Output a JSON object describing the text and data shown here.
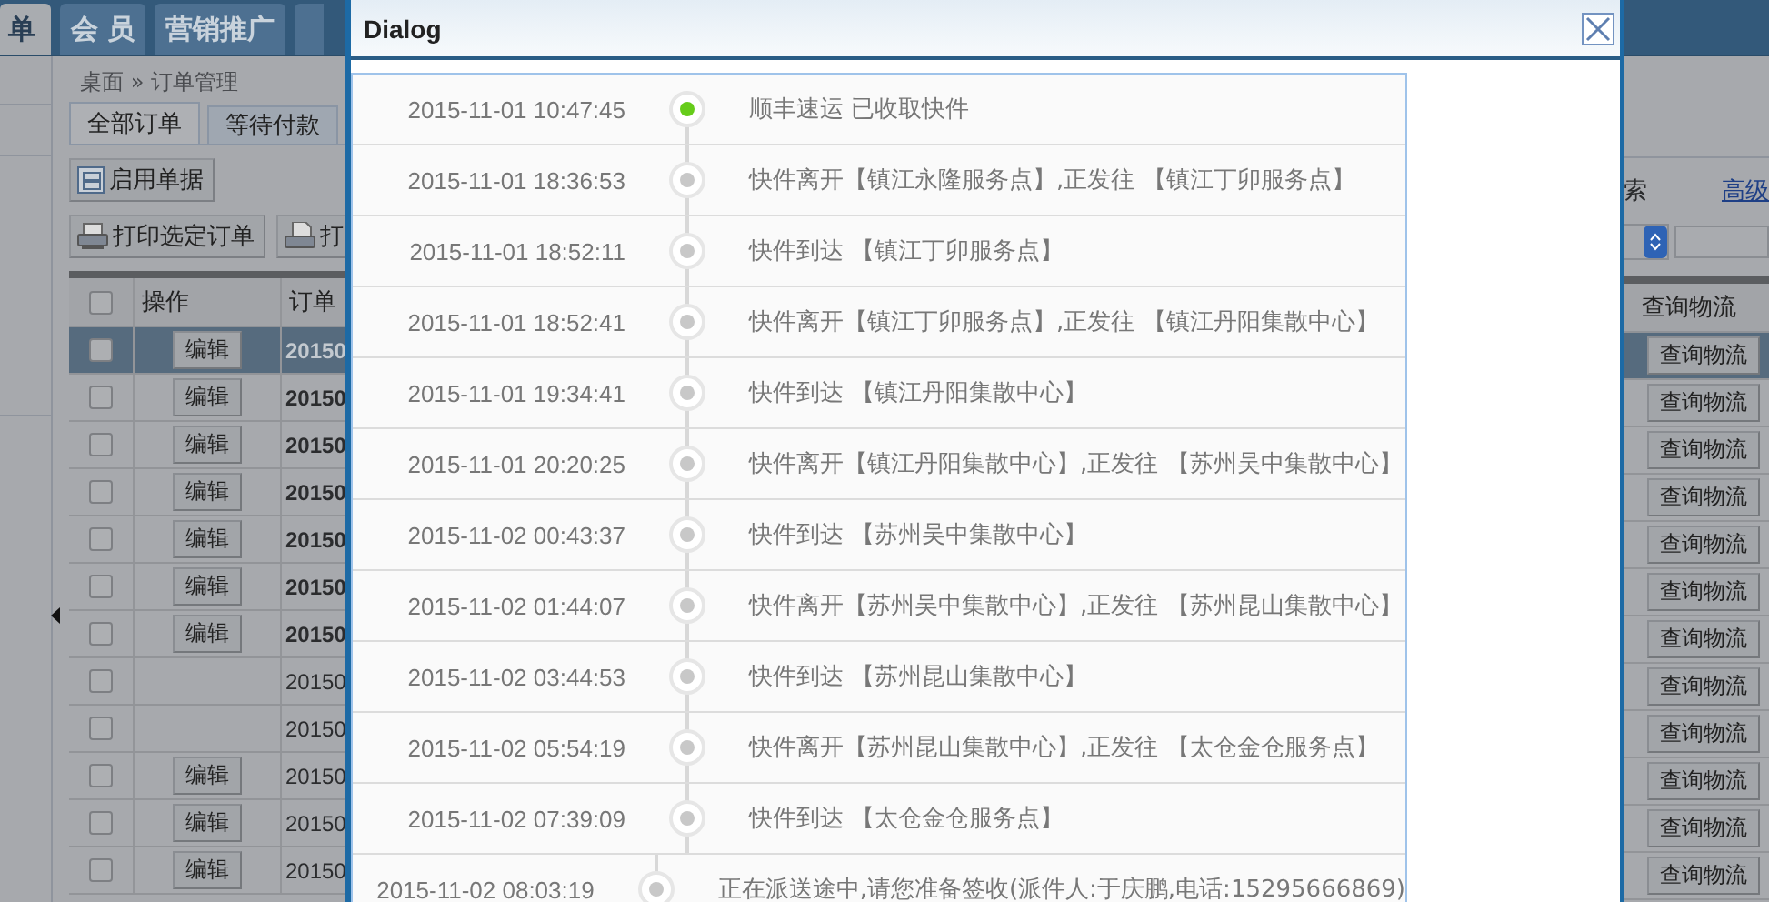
{
  "nav_tabs": [
    {
      "label": "单",
      "selected": true
    },
    {
      "label": "会 员",
      "selected": false
    },
    {
      "label": "营销推广",
      "selected": false
    }
  ],
  "breadcrumb": "桌面 » 订单管理",
  "order_tabs": [
    {
      "label": "全部订单",
      "selected": true
    },
    {
      "label": "等待付款",
      "selected": false
    }
  ],
  "toolbar_rows": [
    [
      {
        "kind": "enable",
        "label": "启用单据"
      }
    ],
    [
      {
        "kind": "print",
        "label": "打印选定订单"
      },
      {
        "kind": "print-doc",
        "label": "打"
      }
    ]
  ],
  "search": {
    "label": "索",
    "link": "高级"
  },
  "grid": {
    "all_checked": false,
    "columns": [
      "操作",
      "订单"
    ],
    "track_column": "查询物流",
    "rows": [
      {
        "checked": false,
        "selected": true,
        "bold": true,
        "edit_label": "编辑",
        "order_no": "20150",
        "track_label": "查询物流"
      },
      {
        "checked": false,
        "selected": false,
        "bold": true,
        "edit_label": "编辑",
        "order_no": "20150",
        "track_label": "查询物流"
      },
      {
        "checked": false,
        "selected": false,
        "bold": true,
        "edit_label": "编辑",
        "order_no": "20150",
        "track_label": "查询物流"
      },
      {
        "checked": false,
        "selected": false,
        "bold": true,
        "edit_label": "编辑",
        "order_no": "20150",
        "track_label": "查询物流"
      },
      {
        "checked": false,
        "selected": false,
        "bold": true,
        "edit_label": "编辑",
        "order_no": "20150",
        "track_label": "查询物流"
      },
      {
        "checked": false,
        "selected": false,
        "bold": true,
        "edit_label": "编辑",
        "order_no": "20150",
        "track_label": "查询物流"
      },
      {
        "checked": false,
        "selected": false,
        "bold": true,
        "edit_label": "编辑",
        "order_no": "20150",
        "track_label": "查询物流"
      },
      {
        "checked": false,
        "selected": false,
        "bold": false,
        "order_no": "20150",
        "track_label": "查询物流"
      },
      {
        "checked": false,
        "selected": false,
        "bold": false,
        "order_no": "20150",
        "track_label": "查询物流"
      },
      {
        "checked": false,
        "selected": false,
        "bold": false,
        "edit_label": "编辑",
        "order_no": "20150",
        "track_label": "查询物流"
      },
      {
        "checked": false,
        "selected": false,
        "bold": false,
        "edit_label": "编辑",
        "order_no": "20150",
        "track_label": "查询物流"
      },
      {
        "checked": false,
        "selected": false,
        "bold": false,
        "edit_label": "编辑",
        "order_no": "20150",
        "track_label": "查询物流"
      }
    ]
  },
  "dialog": {
    "title": "Dialog",
    "events": [
      {
        "time": "2015-11-01 10:47:45",
        "text": "顺丰速运 已收取快件",
        "current": true
      },
      {
        "time": "2015-11-01 18:36:53",
        "text": "快件离开【镇江永隆服务点】,正发往 【镇江丁卯服务点】",
        "current": false
      },
      {
        "time": "2015-11-01 18:52:11",
        "text": "快件到达 【镇江丁卯服务点】",
        "current": false
      },
      {
        "time": "2015-11-01 18:52:41",
        "text": "快件离开【镇江丁卯服务点】,正发往 【镇江丹阳集散中心】",
        "current": false
      },
      {
        "time": "2015-11-01 19:34:41",
        "text": "快件到达 【镇江丹阳集散中心】",
        "current": false
      },
      {
        "time": "2015-11-01 20:20:25",
        "text": "快件离开【镇江丹阳集散中心】,正发往 【苏州吴中集散中心】",
        "current": false
      },
      {
        "time": "2015-11-02 00:43:37",
        "text": "快件到达 【苏州吴中集散中心】",
        "current": false
      },
      {
        "time": "2015-11-02 01:44:07",
        "text": "快件离开【苏州吴中集散中心】,正发往 【苏州昆山集散中心】",
        "current": false
      },
      {
        "time": "2015-11-02 03:44:53",
        "text": "快件到达 【苏州昆山集散中心】",
        "current": false
      },
      {
        "time": "2015-11-02 05:54:19",
        "text": "快件离开【苏州昆山集散中心】,正发往 【太仓金仓服务点】",
        "current": false
      },
      {
        "time": "2015-11-02 07:39:09",
        "text": "快件到达 【太仓金仓服务点】",
        "current": false
      },
      {
        "time": "2015-11-02 08:03:19",
        "text": "正在派送途中,请您准备签收(派件人:于庆鹏,电话:15295666869)",
        "current": false
      }
    ]
  }
}
